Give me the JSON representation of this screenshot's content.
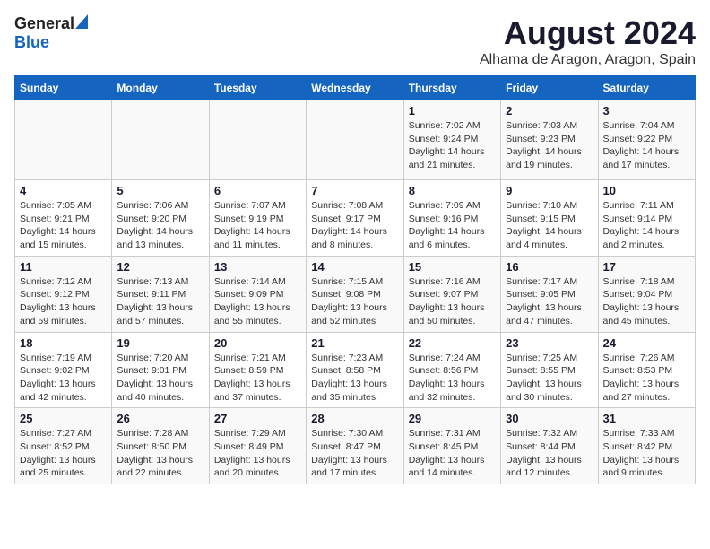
{
  "logo": {
    "general": "General",
    "blue": "Blue"
  },
  "title": "August 2024",
  "subtitle": "Alhama de Aragon, Aragon, Spain",
  "days": [
    "Sunday",
    "Monday",
    "Tuesday",
    "Wednesday",
    "Thursday",
    "Friday",
    "Saturday"
  ],
  "weeks": [
    [
      {
        "date": "",
        "content": ""
      },
      {
        "date": "",
        "content": ""
      },
      {
        "date": "",
        "content": ""
      },
      {
        "date": "",
        "content": ""
      },
      {
        "date": "1",
        "content": "Sunrise: 7:02 AM\nSunset: 9:24 PM\nDaylight: 14 hours and 21 minutes."
      },
      {
        "date": "2",
        "content": "Sunrise: 7:03 AM\nSunset: 9:23 PM\nDaylight: 14 hours and 19 minutes."
      },
      {
        "date": "3",
        "content": "Sunrise: 7:04 AM\nSunset: 9:22 PM\nDaylight: 14 hours and 17 minutes."
      }
    ],
    [
      {
        "date": "4",
        "content": "Sunrise: 7:05 AM\nSunset: 9:21 PM\nDaylight: 14 hours and 15 minutes."
      },
      {
        "date": "5",
        "content": "Sunrise: 7:06 AM\nSunset: 9:20 PM\nDaylight: 14 hours and 13 minutes."
      },
      {
        "date": "6",
        "content": "Sunrise: 7:07 AM\nSunset: 9:19 PM\nDaylight: 14 hours and 11 minutes."
      },
      {
        "date": "7",
        "content": "Sunrise: 7:08 AM\nSunset: 9:17 PM\nDaylight: 14 hours and 8 minutes."
      },
      {
        "date": "8",
        "content": "Sunrise: 7:09 AM\nSunset: 9:16 PM\nDaylight: 14 hours and 6 minutes."
      },
      {
        "date": "9",
        "content": "Sunrise: 7:10 AM\nSunset: 9:15 PM\nDaylight: 14 hours and 4 minutes."
      },
      {
        "date": "10",
        "content": "Sunrise: 7:11 AM\nSunset: 9:14 PM\nDaylight: 14 hours and 2 minutes."
      }
    ],
    [
      {
        "date": "11",
        "content": "Sunrise: 7:12 AM\nSunset: 9:12 PM\nDaylight: 13 hours and 59 minutes."
      },
      {
        "date": "12",
        "content": "Sunrise: 7:13 AM\nSunset: 9:11 PM\nDaylight: 13 hours and 57 minutes."
      },
      {
        "date": "13",
        "content": "Sunrise: 7:14 AM\nSunset: 9:09 PM\nDaylight: 13 hours and 55 minutes."
      },
      {
        "date": "14",
        "content": "Sunrise: 7:15 AM\nSunset: 9:08 PM\nDaylight: 13 hours and 52 minutes."
      },
      {
        "date": "15",
        "content": "Sunrise: 7:16 AM\nSunset: 9:07 PM\nDaylight: 13 hours and 50 minutes."
      },
      {
        "date": "16",
        "content": "Sunrise: 7:17 AM\nSunset: 9:05 PM\nDaylight: 13 hours and 47 minutes."
      },
      {
        "date": "17",
        "content": "Sunrise: 7:18 AM\nSunset: 9:04 PM\nDaylight: 13 hours and 45 minutes."
      }
    ],
    [
      {
        "date": "18",
        "content": "Sunrise: 7:19 AM\nSunset: 9:02 PM\nDaylight: 13 hours and 42 minutes."
      },
      {
        "date": "19",
        "content": "Sunrise: 7:20 AM\nSunset: 9:01 PM\nDaylight: 13 hours and 40 minutes."
      },
      {
        "date": "20",
        "content": "Sunrise: 7:21 AM\nSunset: 8:59 PM\nDaylight: 13 hours and 37 minutes."
      },
      {
        "date": "21",
        "content": "Sunrise: 7:23 AM\nSunset: 8:58 PM\nDaylight: 13 hours and 35 minutes."
      },
      {
        "date": "22",
        "content": "Sunrise: 7:24 AM\nSunset: 8:56 PM\nDaylight: 13 hours and 32 minutes."
      },
      {
        "date": "23",
        "content": "Sunrise: 7:25 AM\nSunset: 8:55 PM\nDaylight: 13 hours and 30 minutes."
      },
      {
        "date": "24",
        "content": "Sunrise: 7:26 AM\nSunset: 8:53 PM\nDaylight: 13 hours and 27 minutes."
      }
    ],
    [
      {
        "date": "25",
        "content": "Sunrise: 7:27 AM\nSunset: 8:52 PM\nDaylight: 13 hours and 25 minutes."
      },
      {
        "date": "26",
        "content": "Sunrise: 7:28 AM\nSunset: 8:50 PM\nDaylight: 13 hours and 22 minutes."
      },
      {
        "date": "27",
        "content": "Sunrise: 7:29 AM\nSunset: 8:49 PM\nDaylight: 13 hours and 20 minutes."
      },
      {
        "date": "28",
        "content": "Sunrise: 7:30 AM\nSunset: 8:47 PM\nDaylight: 13 hours and 17 minutes."
      },
      {
        "date": "29",
        "content": "Sunrise: 7:31 AM\nSunset: 8:45 PM\nDaylight: 13 hours and 14 minutes."
      },
      {
        "date": "30",
        "content": "Sunrise: 7:32 AM\nSunset: 8:44 PM\nDaylight: 13 hours and 12 minutes."
      },
      {
        "date": "31",
        "content": "Sunrise: 7:33 AM\nSunset: 8:42 PM\nDaylight: 13 hours and 9 minutes."
      }
    ]
  ]
}
